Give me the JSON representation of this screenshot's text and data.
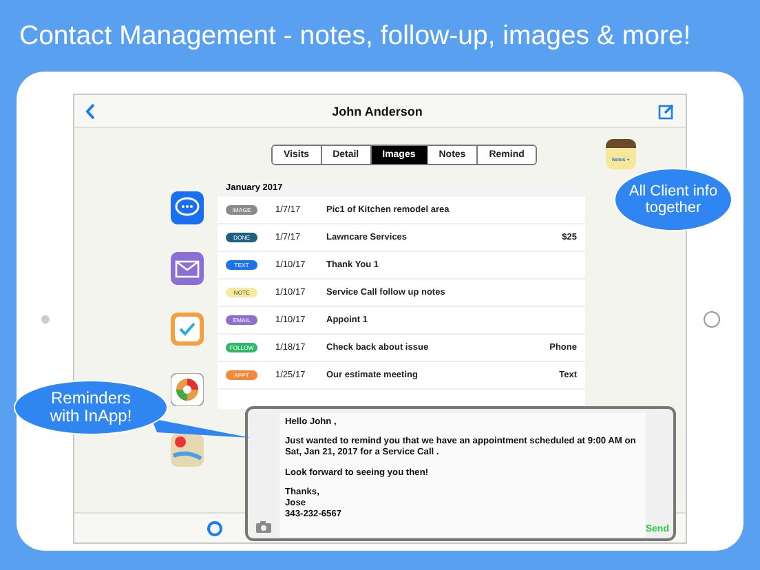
{
  "header": {
    "title": "Contact Management - notes, follow-up, images & more!"
  },
  "nav": {
    "title": "John Anderson"
  },
  "tabs": [
    {
      "label": "Visits",
      "selected": false
    },
    {
      "label": "Detail",
      "selected": false
    },
    {
      "label": "Images",
      "selected": true
    },
    {
      "label": "Notes",
      "selected": false
    },
    {
      "label": "Remind",
      "selected": false
    }
  ],
  "notes_icon": {
    "label": "Notes +"
  },
  "list": {
    "section": "January 2017",
    "rows": [
      {
        "tag": "IMAGE",
        "color": "#8a8a8e",
        "date": "1/7/17",
        "description": "Pic1 of Kitchen remodel area"
      },
      {
        "tag": "DONE",
        "color": "#1f5f80",
        "date": "1/7/17",
        "description": "Lawncare Services",
        "detail": "$25"
      },
      {
        "tag": "TEXT",
        "color": "#1a73e8",
        "date": "1/10/17",
        "description": "Thank You 1"
      },
      {
        "tag": "NOTE",
        "color": "#f5eaa0",
        "date": "1/10/17",
        "description": "Service Call follow up notes"
      },
      {
        "tag": "EMAIL",
        "color": "#8e6fd1",
        "date": "1/10/17",
        "description": "Appoint 1"
      },
      {
        "tag": "FOLLOW",
        "color": "#2fb86a",
        "date": "1/18/17",
        "description": "Check back about issue",
        "detail": "Phone"
      },
      {
        "tag": "APPT",
        "color": "#f5873a",
        "date": "1/25/17",
        "description": "Our estimate meeting",
        "detail": "Text"
      }
    ]
  },
  "message": {
    "paragraphs": [
      "Hello John ,",
      "Just wanted to remind you that we have an appointment scheduled at 9:00 AM on Sat, Jan 21, 2017 for a Service Call .",
      "Look forward to seeing you then!",
      "Thanks,\nJose\n343-232-6567"
    ],
    "send": "Send"
  },
  "callouts": [
    {
      "text": "All Client info\ntogether"
    },
    {
      "text": "Reminders\nwith InApp!"
    }
  ]
}
